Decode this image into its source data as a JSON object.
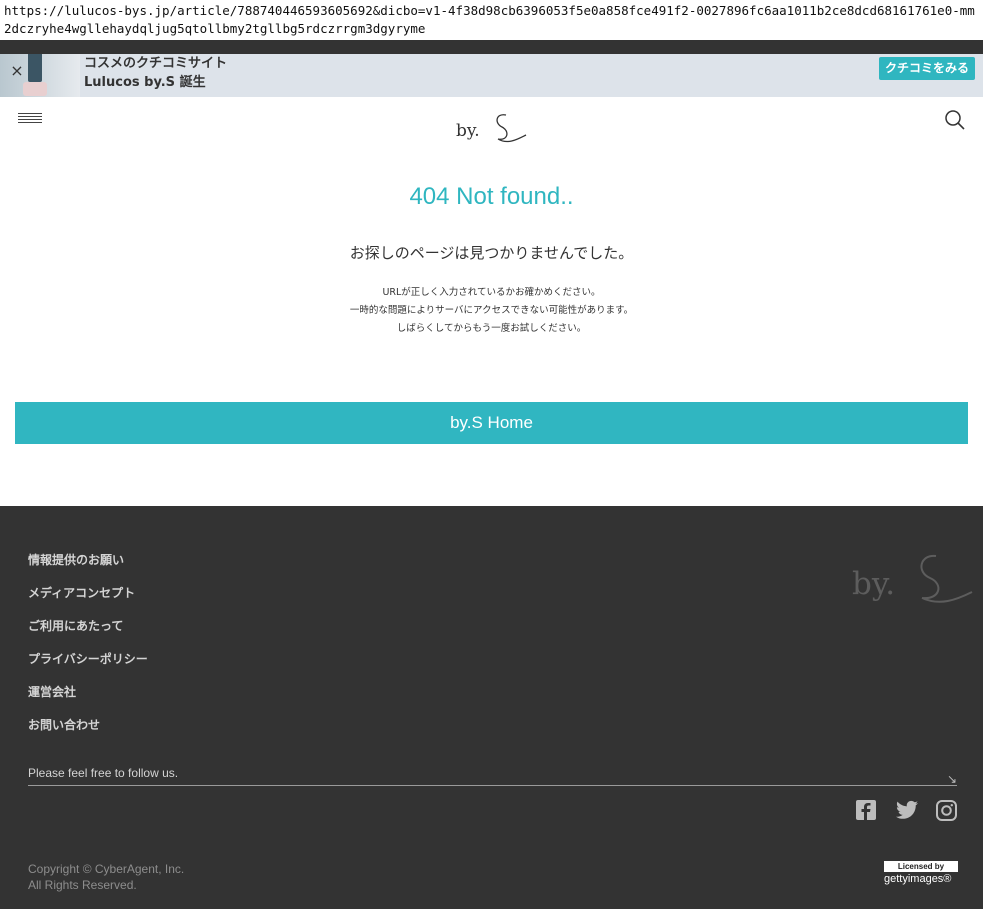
{
  "browser": {
    "url": "https://lulucos-bys.jp/article/788740446593605692&dicbo=v1-4f38d98cb6396053f5e0a858fce491f2-0027896fc6aa1011b2ce8dcd68161761e0-mm2dczryhe4wgllehaydqljug5qtollbmy2tgllbg5rdczrrgm3dgyryme"
  },
  "promo": {
    "line1": "コスメのクチコミサイト",
    "line2": "Lulucos by.S 誕生",
    "button": "クチコミをみる",
    "close": "×"
  },
  "header": {
    "logo": "by.S"
  },
  "notfound": {
    "title": "404 Not found..",
    "subtitle": "お探しのページは見つかりませんでした。",
    "lines": [
      "URLが正しく入力されているかお確かめください。",
      "一時的な問題によりサーバにアクセスできない可能性があります。",
      "しばらくしてからもう一度お試しください。"
    ],
    "home_button": "by.S Home"
  },
  "footer": {
    "links": [
      "情報提供のお願い",
      "メディアコンセプト",
      "ご利用にあたって",
      "プライバシーポリシー",
      "運営会社",
      "お問い合わせ"
    ],
    "follow": "Please feel free to follow us.",
    "copyright1": "Copyright © CyberAgent, Inc.",
    "copyright2": "All Rights Reserved.",
    "getty_licensed": "Licensed by",
    "getty_brand": "gettyimages®"
  },
  "colors": {
    "accent": "#30b6c1",
    "footer_bg": "#333333",
    "promo_bg": "#dde3ea"
  },
  "icons": [
    "close-icon",
    "menu-icon",
    "search-icon",
    "facebook-icon",
    "twitter-icon",
    "instagram-icon"
  ]
}
